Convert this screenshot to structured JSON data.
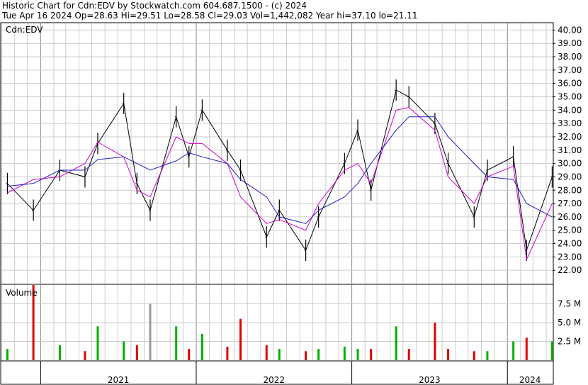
{
  "header": {
    "title": "Historic Chart for Cdn:EDV by Stockwatch.com 604.687.1500 - (c) 2024",
    "quote": "Tue Apr 16 2024   Op=28.63  Hi=29.51  Lo=28.58  Cl=29.03  Vol=1,442,082  Year hi=37.10  lo=21.11"
  },
  "chart_data": [
    {
      "type": "line",
      "panel": "price",
      "title": "Cdn:EDV",
      "ylim": [
        21.0,
        40.5
      ],
      "yticks": [
        "40.00",
        "39.00",
        "38.00",
        "37.00",
        "36.00",
        "35.00",
        "34.00",
        "33.00",
        "32.00",
        "31.00",
        "30.00",
        "29.00",
        "28.00",
        "27.00",
        "26.00",
        "25.00",
        "24.00",
        "23.00",
        "22.00"
      ],
      "xticks": [
        "2021",
        "2022",
        "2023",
        "2024"
      ],
      "grid": true,
      "series": [
        {
          "style": "high-low bars",
          "color": "#000000",
          "x": [
            "2020-10",
            "2020-12",
            "2021-02",
            "2021-04",
            "2021-05",
            "2021-07",
            "2021-08",
            "2021-09",
            "2021-11",
            "2021-12",
            "2022-01",
            "2022-03",
            "2022-04",
            "2022-06",
            "2022-07",
            "2022-09",
            "2022-10",
            "2022-12",
            "2023-01",
            "2023-02",
            "2023-04",
            "2023-05",
            "2023-07",
            "2023-08",
            "2023-10",
            "2023-11",
            "2024-01",
            "2024-02",
            "2024-04"
          ],
          "values": [
            28.5,
            26.5,
            29.5,
            29.0,
            31.5,
            34.5,
            28.5,
            26.5,
            33.5,
            30.5,
            34.0,
            31.0,
            29.5,
            24.5,
            26.5,
            23.5,
            26.0,
            30.0,
            32.5,
            28.0,
            35.5,
            35.0,
            33.0,
            30.0,
            26.0,
            29.5,
            30.5,
            23.5,
            29.0
          ]
        },
        {
          "style": "line",
          "color": "#d000d0",
          "x": [
            "2020-10",
            "2020-12",
            "2021-02",
            "2021-04",
            "2021-05",
            "2021-07",
            "2021-08",
            "2021-09",
            "2021-11",
            "2021-12",
            "2022-01",
            "2022-03",
            "2022-04",
            "2022-06",
            "2022-07",
            "2022-09",
            "2022-10",
            "2022-12",
            "2023-01",
            "2023-02",
            "2023-04",
            "2023-05",
            "2023-07",
            "2023-08",
            "2023-10",
            "2023-11",
            "2024-01",
            "2024-02",
            "2024-04"
          ],
          "values": [
            27.8,
            28.8,
            29.0,
            30.0,
            31.6,
            30.5,
            28.0,
            27.5,
            32.0,
            31.5,
            31.5,
            30.0,
            27.5,
            25.5,
            25.8,
            25.0,
            27.0,
            29.5,
            30.0,
            28.5,
            34.0,
            34.2,
            32.5,
            29.0,
            27.0,
            29.0,
            29.8,
            22.8,
            27.0
          ]
        },
        {
          "style": "line",
          "color": "#2020c0",
          "x": [
            "2020-10",
            "2020-12",
            "2021-02",
            "2021-04",
            "2021-05",
            "2021-07",
            "2021-08",
            "2021-09",
            "2021-11",
            "2021-12",
            "2022-01",
            "2022-03",
            "2022-04",
            "2022-06",
            "2022-07",
            "2022-09",
            "2022-10",
            "2022-12",
            "2023-01",
            "2023-02",
            "2023-04",
            "2023-05",
            "2023-07",
            "2023-08",
            "2023-10",
            "2023-11",
            "2024-01",
            "2024-02",
            "2024-04"
          ],
          "values": [
            28.3,
            28.5,
            29.5,
            29.5,
            30.3,
            30.5,
            30.0,
            29.5,
            30.2,
            30.8,
            30.5,
            30.0,
            28.8,
            27.5,
            26.0,
            25.5,
            26.5,
            27.5,
            28.5,
            30.0,
            32.5,
            33.5,
            33.5,
            32.0,
            30.0,
            29.0,
            28.8,
            27.0,
            26.0
          ]
        }
      ]
    },
    {
      "type": "bar",
      "panel": "volume",
      "title": "Volume",
      "ylim": [
        0,
        10
      ],
      "yticks": [
        "7.5 M",
        "5.0 M",
        "2.5 M"
      ],
      "colors": {
        "up": "#00b000",
        "down": "#e00000",
        "spike": "#999999"
      },
      "x": [
        "2020-10",
        "2020-12",
        "2021-02",
        "2021-04",
        "2021-05",
        "2021-07",
        "2021-08",
        "2021-09",
        "2021-11",
        "2021-12",
        "2022-01",
        "2022-03",
        "2022-04",
        "2022-06",
        "2022-07",
        "2022-09",
        "2022-10",
        "2022-12",
        "2023-01",
        "2023-02",
        "2023-04",
        "2023-05",
        "2023-07",
        "2023-08",
        "2023-10",
        "2023-11",
        "2024-01",
        "2024-02",
        "2024-04"
      ],
      "values": [
        1.5,
        10.0,
        2.0,
        1.2,
        4.5,
        2.5,
        2.0,
        7.5,
        4.5,
        1.5,
        3.5,
        1.8,
        5.5,
        2.0,
        1.5,
        1.2,
        1.5,
        1.8,
        1.5,
        1.5,
        4.5,
        1.5,
        5.0,
        1.5,
        1.2,
        1.2,
        2.5,
        3.0,
        2.5
      ]
    }
  ]
}
